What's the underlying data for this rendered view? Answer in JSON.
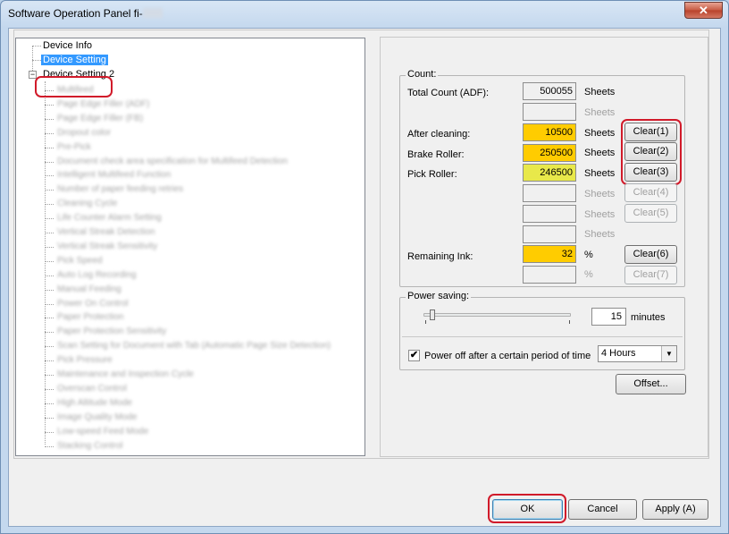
{
  "window": {
    "title": "Software Operation Panel fi-",
    "close_glyph": "✕"
  },
  "tree": {
    "device_info": "Device Info",
    "device_setting": "Device Setting",
    "device_setting_2": "Device Setting 2",
    "expander_glyph": "−",
    "children": [
      "Multifeed",
      "Page Edge Filler (ADF)",
      "Page Edge Filler (FB)",
      "Dropout color",
      "Pre-Pick",
      "Document check area specification for Multifeed Detection",
      "Intelligent Multifeed Function",
      "Number of paper feeding retries",
      "Cleaning Cycle",
      "Life Counter Alarm Setting",
      "Vertical Streak Detection",
      "Vertical Streak Sensitivity",
      "Pick Speed",
      "Auto Log Recording",
      "Manual Feeding",
      "Power On Control",
      "Paper Protection",
      "Paper Protection Sensitivity",
      "Scan Setting for Document with Tab (Automatic Page Size Detection)",
      "Pick Pressure",
      "Maintenance and Inspection Cycle",
      "Overscan Control",
      "High Altitude Mode",
      "Image Quality Mode",
      "Low-speed Feed Mode",
      "Stacking Control"
    ]
  },
  "count": {
    "group_title": "Count:",
    "total_label": "Total Count (ADF):",
    "total_value": "500055",
    "after_cleaning_label": "After cleaning:",
    "after_cleaning_value": "10500",
    "brake_roller_label": "Brake Roller:",
    "brake_roller_value": "250500",
    "pick_roller_label": "Pick Roller:",
    "pick_roller_value": "246500",
    "remaining_ink_label": "Remaining Ink:",
    "remaining_ink_value": "32",
    "sheets": "Sheets",
    "percent": "%",
    "clear1": "Clear(1)",
    "clear2": "Clear(2)",
    "clear3": "Clear(3)",
    "clear4": "Clear(4)",
    "clear5": "Clear(5)",
    "clear6": "Clear(6)",
    "clear7": "Clear(7)"
  },
  "power": {
    "group_title": "Power saving:",
    "minutes_value": "15",
    "minutes_label": "minutes",
    "slider_position_fraction": 0.06,
    "power_off_label": "Power off after a certain period of time",
    "power_off_checked": true,
    "check_glyph": "✔",
    "hours_value": "4 Hours",
    "combo_arrow_glyph": "▼"
  },
  "offset_label": "Offset...",
  "footer": {
    "ok": "OK",
    "cancel": "Cancel",
    "apply": "Apply (A)"
  },
  "colors": {
    "highlight_orange": "#ffcc00",
    "highlight_yellow": "#e8e84a",
    "annotation_red": "#d11a2a",
    "selection_blue": "#3399ff"
  }
}
